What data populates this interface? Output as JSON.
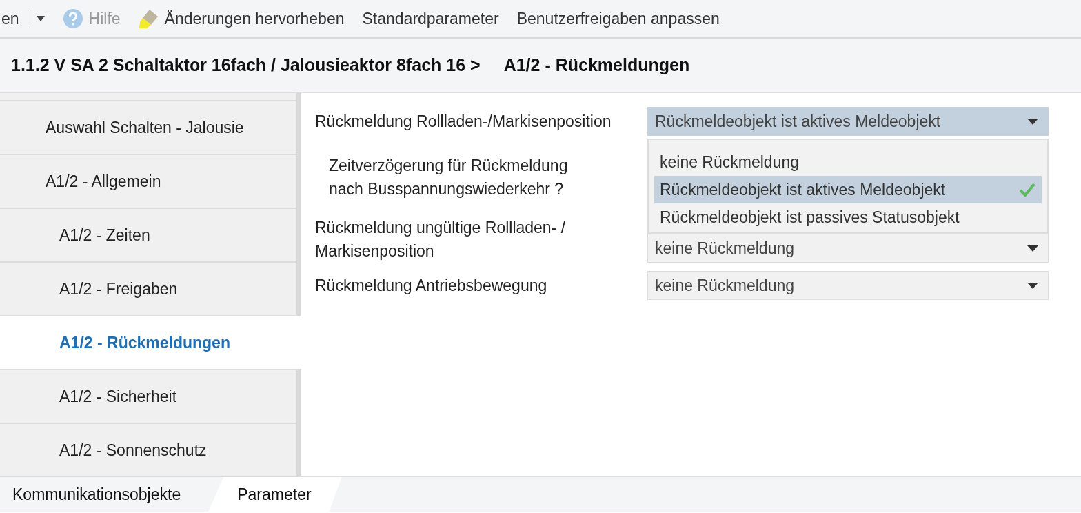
{
  "toolbar": {
    "items": [
      {
        "kind": "text",
        "label": "en",
        "disabled": false
      },
      {
        "kind": "caret"
      },
      {
        "kind": "help",
        "label": "Hilfe",
        "disabled": true
      },
      {
        "kind": "highlight",
        "label": "Änderungen hervorheben",
        "disabled": false
      },
      {
        "kind": "text",
        "label": "Standardparameter",
        "disabled": false
      },
      {
        "kind": "text",
        "label": "Benutzerfreigaben anpassen",
        "disabled": false
      }
    ]
  },
  "header": {
    "device": "1.1.2 V SA 2 Schaltaktor 16fach / Jalousieaktor 8fach 16 >",
    "section": "A1/2 - Rückmeldungen"
  },
  "sidebar": {
    "items": [
      {
        "label": "Auswahl Schalten - Jalousie",
        "selected": false
      },
      {
        "label": "A1/2 - Allgemein",
        "selected": false,
        "children": [
          {
            "label": "A1/2 - Zeiten",
            "selected": false
          },
          {
            "label": "A1/2 - Freigaben",
            "selected": false
          },
          {
            "label": "A1/2 - Rückmeldungen",
            "selected": true
          },
          {
            "label": "A1/2 - Sicherheit",
            "selected": false
          },
          {
            "label": "A1/2 - Sonnenschutz",
            "selected": false
          }
        ]
      }
    ]
  },
  "parameters": [
    {
      "label": "Rückmeldung Rollladen-/Markisenposition",
      "value": "Rückmeldeobjekt ist aktives Meldeobjekt",
      "expanded": true,
      "options": [
        {
          "label": "keine Rückmeldung",
          "selected": false
        },
        {
          "label": "Rückmeldeobjekt ist aktives Meldeobjekt",
          "selected": true
        },
        {
          "label": "Rückmeldeobjekt ist passives Statusobjekt",
          "selected": false
        }
      ],
      "children": [
        {
          "label": "Zeitverzögerung für Rückmeldung nach Busspannungswiederkehr ?"
        }
      ]
    },
    {
      "label": "Rückmeldung ungültige Rollladen- / Markisenposition",
      "value": "keine Rückmeldung",
      "expanded": false
    },
    {
      "label": "Rückmeldung Antriebsbewegung",
      "value": "keine Rückmeldung",
      "expanded": false
    }
  ],
  "bottom_tabs": [
    {
      "label": "Kommunikationsobjekte",
      "selected": false
    },
    {
      "label": "Parameter",
      "selected": true
    }
  ]
}
